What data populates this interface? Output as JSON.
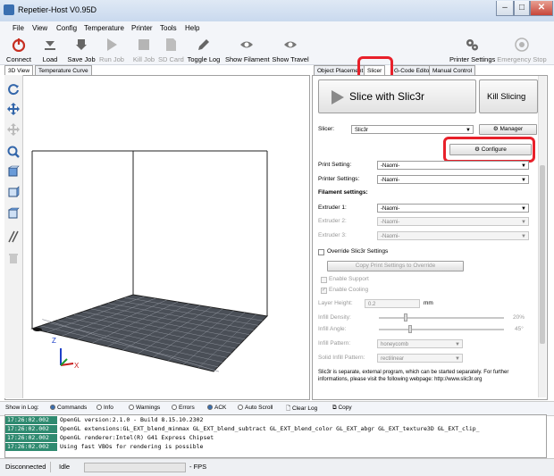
{
  "window": {
    "title": "Repetier-Host V0.95D"
  },
  "menu": [
    "File",
    "View",
    "Config",
    "Temperature",
    "Printer",
    "Tools",
    "Help"
  ],
  "toolbar": {
    "connect": "Connect",
    "load": "Load",
    "save_job": "Save Job",
    "run_job": "Run Job",
    "kill_job": "Kill Job",
    "sd_card": "SD Card",
    "toggle_log": "Toggle Log",
    "show_filament": "Show Filament",
    "show_travel": "Show Travel",
    "printer_settings": "Printer Settings",
    "emergency_stop": "Emergency Stop"
  },
  "left_tabs": [
    "3D View",
    "Temperature Curve"
  ],
  "right_tabs": [
    "Object Placement",
    "Slicer",
    "G-Code Editor",
    "Manual Control"
  ],
  "slicer": {
    "slice_button": "Slice with Slic3r",
    "kill_button": "Kill Slicing",
    "slicer_label": "Slicer:",
    "slicer_value": "Slic3r",
    "manager_button": "Manager",
    "configure_button": "Configure",
    "print_setting_label": "Print Setting:",
    "print_setting_value": "-Naomi-",
    "printer_settings_label": "Printer Settings:",
    "printer_settings_value": "-Naomi-",
    "filament_heading": "Filament settings:",
    "extruder1_label": "Extruder 1:",
    "extruder1_value": "-Naomi-",
    "extruder2_label": "Extruder 2:",
    "extruder2_value": "-Naomi-",
    "extruder3_label": "Extruder 3:",
    "extruder3_value": "-Naomi-",
    "override_label": "Override Slic3r Settings",
    "copy_button": "Copy Print Settings to Override",
    "enable_support": "Enable Support",
    "enable_cooling": "Enable Cooling",
    "layer_height_label": "Layer Height:",
    "layer_height_value": "0.2",
    "layer_height_unit": "mm",
    "infill_density_label": "Infill Density:",
    "infill_density_value": "20%",
    "infill_density_fraction": 0.2,
    "infill_angle_label": "Infill Angle:",
    "infill_angle_value": "45°",
    "infill_pattern_label": "Infill Pattern:",
    "infill_pattern_value": "honeycomb",
    "solid_infill_label": "Solid Infill Pattern:",
    "solid_infill_value": "rectilinear",
    "info_line1": "Slic3r is separate, external program, which can be started separately. For further",
    "info_line2": "informations, please visit the following webpage: http://www.slic3r.org"
  },
  "log_bar": {
    "show_in_log": "Show in Log:",
    "commands": "Commands",
    "info": "Info",
    "warnings": "Warnings",
    "errors": "Errors",
    "ack": "ACK",
    "auto_scroll": "Auto Scroll",
    "clear_log": "Clear Log",
    "copy": "Copy"
  },
  "log": [
    {
      "time": "17:26:02.002",
      "msg": "OpenGL version:2.1.0 - Build 8.15.10.2302"
    },
    {
      "time": "17:26:02.002",
      "msg": "OpenGL extensions:GL_EXT_blend_minmax GL_EXT_blend_subtract GL_EXT_blend_color GL_EXT_abgr GL_EXT_texture3D GL_EXT_clip_"
    },
    {
      "time": "17:26:02.002",
      "msg": "OpenGL renderer:Intel(R) G41 Express Chipset"
    },
    {
      "time": "17:26:02.002",
      "msg": "Using fast VBOs for rendering is possible"
    }
  ],
  "status": {
    "connection": "Disconnected",
    "state": "Idle",
    "fps": "- FPS"
  },
  "axes": {
    "x": "X",
    "y": "Y",
    "z": "Z"
  },
  "colors": {
    "highlight": "#e8202a",
    "log_time_bg": "#2f8a70"
  }
}
